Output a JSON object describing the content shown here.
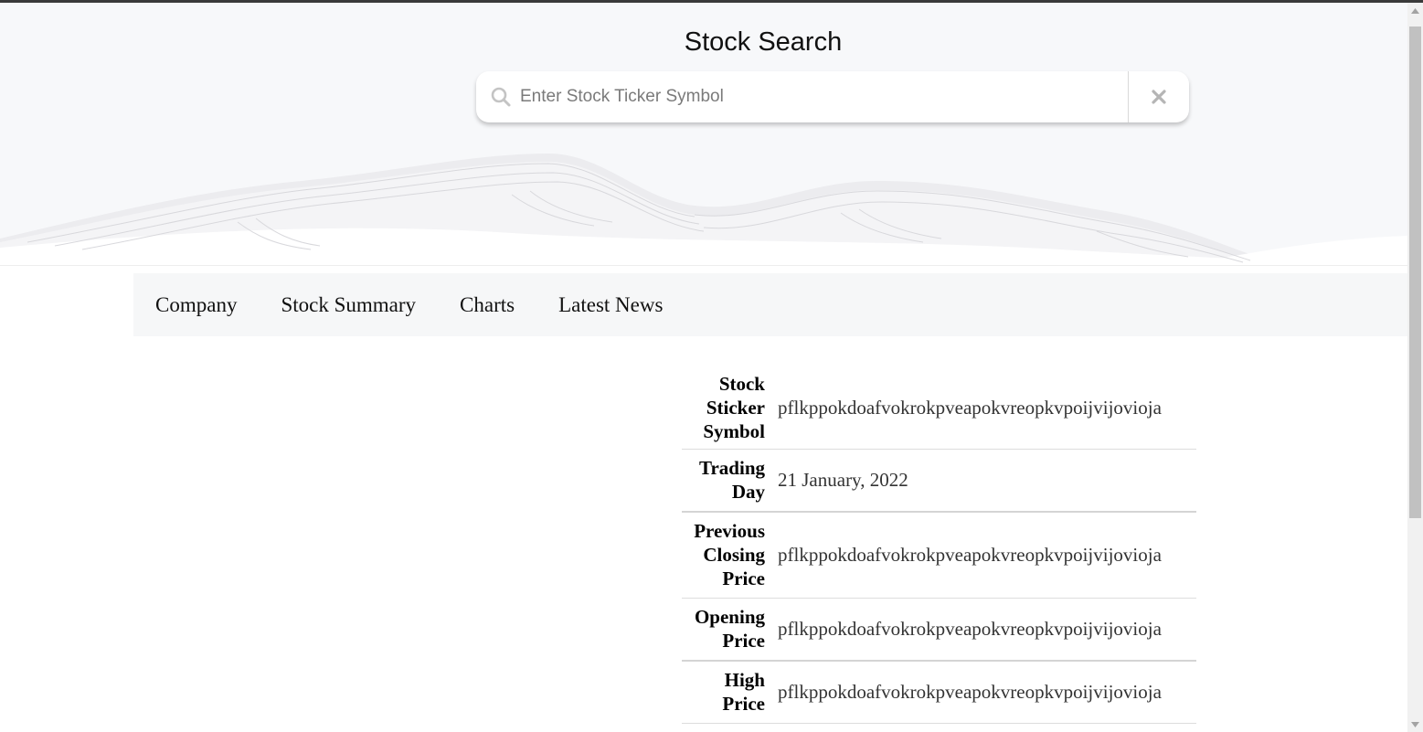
{
  "header": {
    "title": "Stock Search"
  },
  "search": {
    "placeholder": "Enter Stock Ticker Symbol",
    "value": "",
    "search_icon": "search-icon",
    "clear_icon": "close-icon"
  },
  "tabs": [
    {
      "label": "Company"
    },
    {
      "label": "Stock Summary"
    },
    {
      "label": "Charts"
    },
    {
      "label": "Latest News"
    }
  ],
  "summary": {
    "rows": [
      {
        "label_lines": [
          "Stock",
          "Sticker",
          "Symbol"
        ],
        "value": "pflkppokdoafvokrokpveapokvreopkvpoijvijovioja"
      },
      {
        "label_lines": [
          "Trading",
          "Day"
        ],
        "value": "21 January, 2022"
      },
      {
        "label_lines": [
          "Previous",
          "Closing",
          "Price"
        ],
        "value": "pflkppokdoafvokrokpveapokvreopkvpoijvijovioja"
      },
      {
        "label_lines": [
          "Opening",
          "Price"
        ],
        "value": "pflkppokdoafvokrokpveapokvreopkvpoijvijovioja"
      },
      {
        "label_lines": [
          "High",
          "Price"
        ],
        "value": "pflkppokdoafvokrokpveapokvreopkvpoijvijovioja"
      }
    ]
  },
  "colors": {
    "header_background": "#f7f8fa",
    "tab_bar_background": "#f6f7f8",
    "row_border": "#dddddd"
  }
}
